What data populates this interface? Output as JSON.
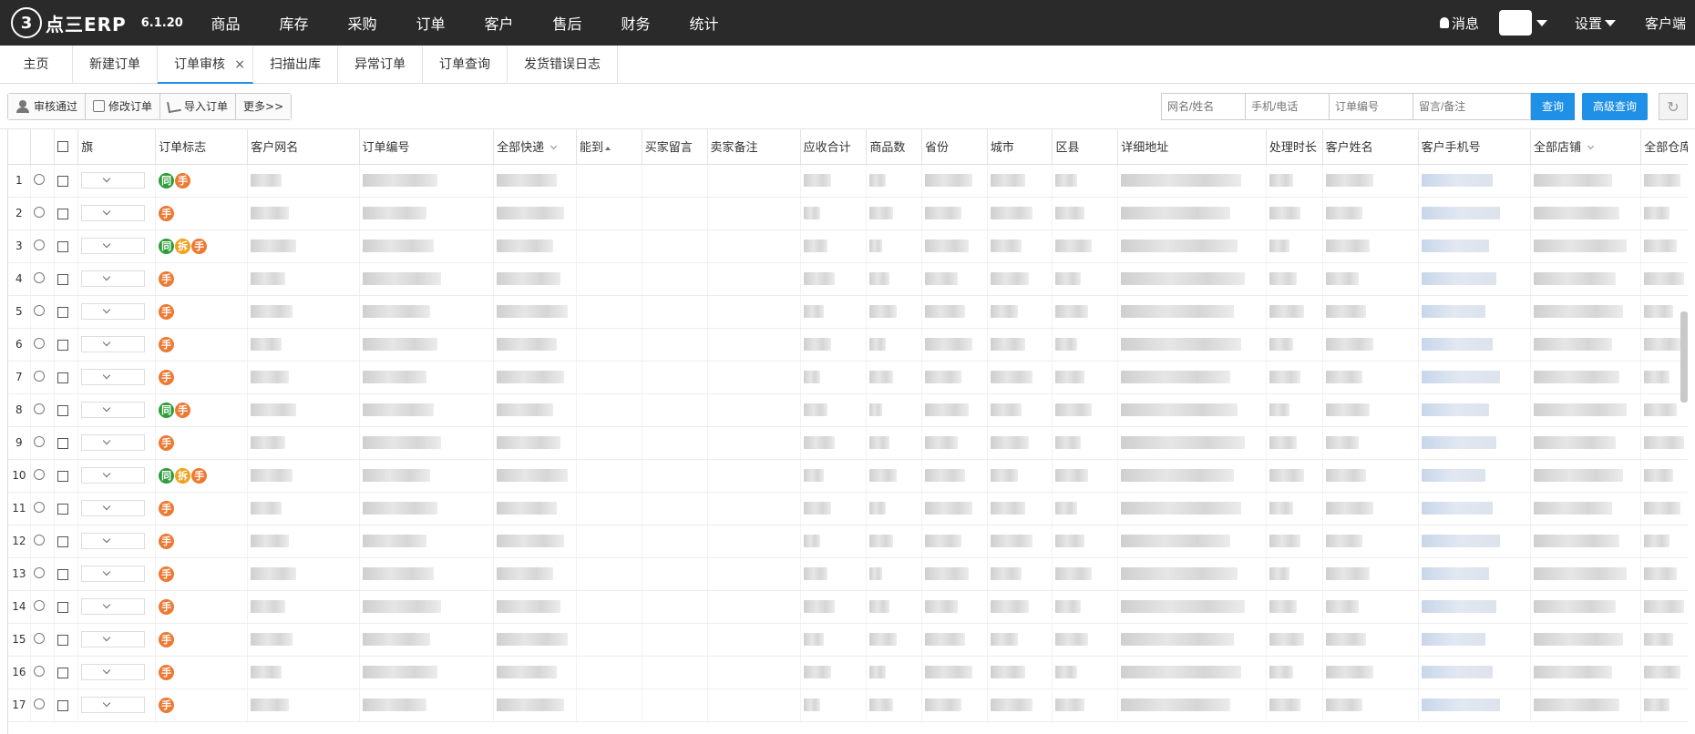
{
  "app": {
    "logo_mark": "3",
    "logo_text": "点三ERP",
    "version": "6.1.20"
  },
  "nav": {
    "items": [
      "商品",
      "库存",
      "采购",
      "订单",
      "客户",
      "售后",
      "财务",
      "统计"
    ],
    "messages": "消息",
    "settings": "设置",
    "client": "客户端"
  },
  "tabs": [
    {
      "label": "主页",
      "active": false
    },
    {
      "label": "新建订单",
      "active": false
    },
    {
      "label": "订单审核",
      "active": true
    },
    {
      "label": "扫描出库",
      "active": false
    },
    {
      "label": "异常订单",
      "active": false
    },
    {
      "label": "订单查询",
      "active": false
    },
    {
      "label": "发货错误日志",
      "active": false
    }
  ],
  "tab_close": "×",
  "toolbar": {
    "approve": "审核通过",
    "edit": "修改订单",
    "import": "导入订单",
    "more": "更多>>"
  },
  "search": {
    "placeholder_name": "网名/姓名",
    "placeholder_phone": "手机/电话",
    "placeholder_order": "订单编号",
    "placeholder_note": "留言/备注",
    "query": "查询",
    "advanced": "高级查询",
    "refresh": "↻"
  },
  "table": {
    "columns": [
      "",
      "",
      "",
      "旗",
      "订单标志",
      "客户网名",
      "订单编号",
      "全部快递",
      "能到",
      "买家留言",
      "卖家备注",
      "应收合计",
      "商品数",
      "省份",
      "城市",
      "区县",
      "详细地址",
      "处理时长",
      "客户姓名",
      "客户手机号",
      "全部店铺",
      "全部仓库"
    ],
    "rows": [
      {
        "n": "1",
        "badges": [
          "同",
          "手"
        ]
      },
      {
        "n": "2",
        "badges": [
          "手"
        ]
      },
      {
        "n": "3",
        "badges": [
          "同",
          "拆",
          "手"
        ]
      },
      {
        "n": "4",
        "badges": [
          "手"
        ]
      },
      {
        "n": "5",
        "badges": [
          "手"
        ]
      },
      {
        "n": "6",
        "badges": [
          "手"
        ]
      },
      {
        "n": "7",
        "badges": [
          "手"
        ]
      },
      {
        "n": "8",
        "badges": [
          "同",
          "手"
        ]
      },
      {
        "n": "9",
        "badges": [
          "手"
        ]
      },
      {
        "n": "10",
        "badges": [
          "同",
          "拆",
          "手"
        ]
      },
      {
        "n": "11",
        "badges": [
          "手"
        ]
      },
      {
        "n": "12",
        "badges": [
          "手"
        ]
      },
      {
        "n": "13",
        "badges": [
          "手"
        ]
      },
      {
        "n": "14",
        "badges": [
          "手"
        ]
      },
      {
        "n": "15",
        "badges": [
          "手"
        ]
      },
      {
        "n": "16",
        "badges": [
          "手"
        ]
      },
      {
        "n": "17",
        "badges": [
          "手"
        ]
      }
    ]
  },
  "colors": {
    "nav_bg": "#2a2a2a",
    "accent": "#1e90e6",
    "badge_tong": "#2e9e39",
    "badge_chai": "#f0a01a",
    "badge_shou": "#ec7a34"
  }
}
